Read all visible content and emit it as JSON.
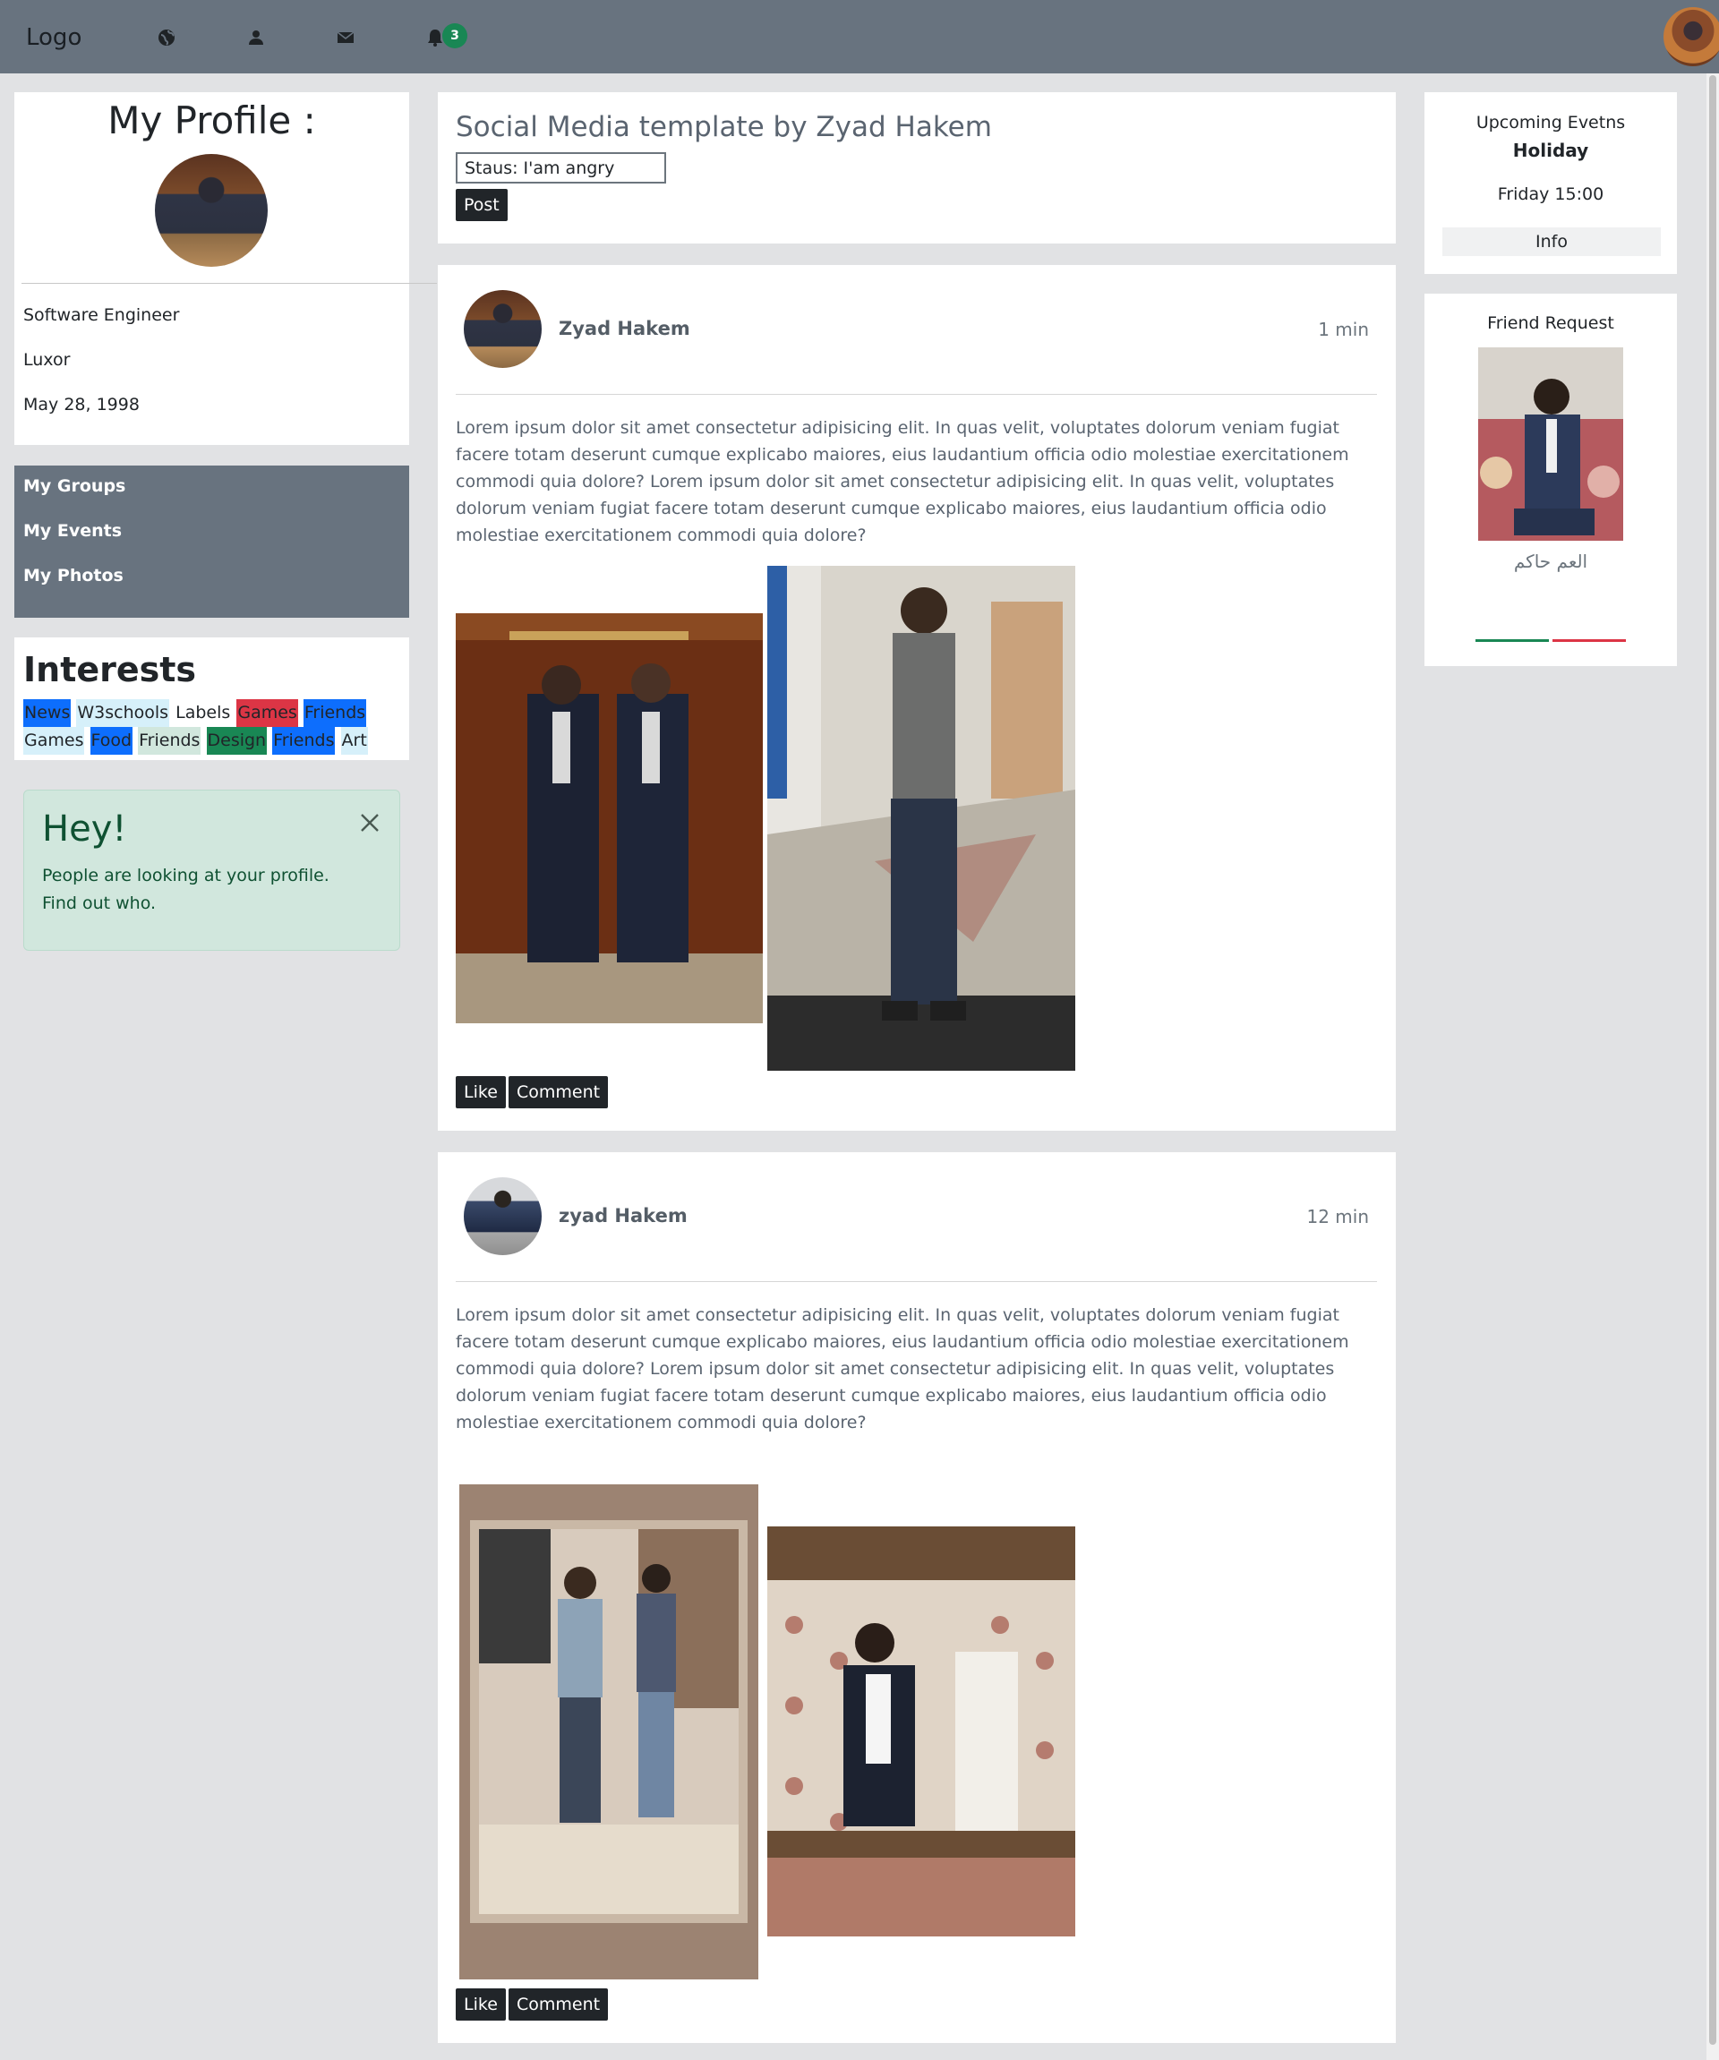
{
  "navbar": {
    "logo": "Logo",
    "icons": [
      "globe-icon",
      "user-icon",
      "envelope-icon",
      "bell-icon"
    ],
    "notification_count": "3"
  },
  "profile": {
    "title": "My Profile :",
    "job": "Software Engineer",
    "city": "Luxor",
    "birthday": "May 28, 1998"
  },
  "menu": {
    "items": [
      "My Groups",
      "My Events",
      "My Photos"
    ]
  },
  "interests": {
    "title": "Interests",
    "tags": [
      "News",
      "W3schools",
      "Labels",
      "Games",
      "Friends",
      "Games",
      "Food",
      "Friends",
      "Design",
      "Friends",
      "Art"
    ]
  },
  "alert": {
    "title": "Hey!",
    "text": "People are looking at your profile. Find out who."
  },
  "composer": {
    "title": "Social Media template by Zyad Hakem",
    "status_value": "Staus: I'am angry",
    "post_button": "Post"
  },
  "posts": [
    {
      "author": "Zyad Hakem",
      "time": "1 min",
      "text": "Lorem ipsum dolor sit amet consectetur adipisicing elit. In quas velit, voluptates dolorum veniam fugiat facere totam deserunt cumque explicabo maiores, eius laudantium officia odio molestiae exercitationem commodi quia dolore? Lorem ipsum dolor sit amet consectetur adipisicing elit. In quas velit, voluptates dolorum veniam fugiat facere totam deserunt cumque explicabo maiores, eius laudantium officia odio molestiae exercitationem commodi quia dolore?",
      "like": "Like",
      "comment": "Comment"
    },
    {
      "author": "zyad Hakem",
      "time": "12 min",
      "text": "Lorem ipsum dolor sit amet consectetur adipisicing elit. In quas velit, voluptates dolorum veniam fugiat facere totam deserunt cumque explicabo maiores, eius laudantium officia odio molestiae exercitationem commodi quia dolore? Lorem ipsum dolor sit amet consectetur adipisicing elit. In quas velit, voluptates dolorum veniam fugiat facere totam deserunt cumque explicabo maiores, eius laudantium officia odio molestiae exercitationem commodi quia dolore?",
      "like": "Like",
      "comment": "Comment"
    }
  ],
  "events": {
    "title": "Upcoming Evetns",
    "name": "Holiday",
    "time": "Friday 15:00",
    "info_button": "Info"
  },
  "friend_request": {
    "title": "Friend Request",
    "name": "العم حاكم"
  },
  "colors": {
    "navbar": "#68737f",
    "page_bg": "#e1e2e4",
    "badge": "#198754",
    "alert_bg": "#d1e7dd",
    "tag_blue": "#0d6efd",
    "tag_red": "#dc3545",
    "tag_green": "#198754"
  }
}
